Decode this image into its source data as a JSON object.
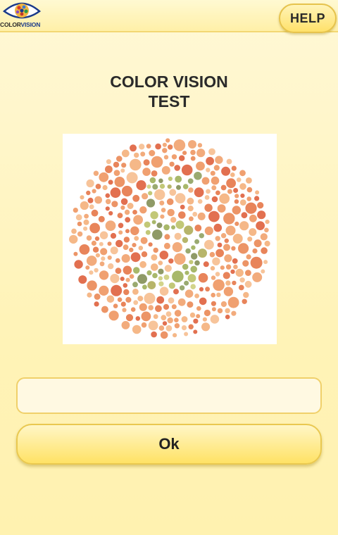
{
  "app": {
    "logo_text_prefix": "COLOR",
    "logo_text_suffix": "VISION"
  },
  "header": {
    "help_label": "HELP"
  },
  "main": {
    "title_line1": "COLOR VISION",
    "title_line2": "TEST",
    "answer_value": "",
    "answer_placeholder": "",
    "ok_label": "Ok"
  },
  "colors": {
    "background": "#fff3b8",
    "button": "#ffe16a",
    "border": "#e6c34d",
    "plate_figure": "#a8b86a",
    "plate_background": "#e8845a"
  }
}
